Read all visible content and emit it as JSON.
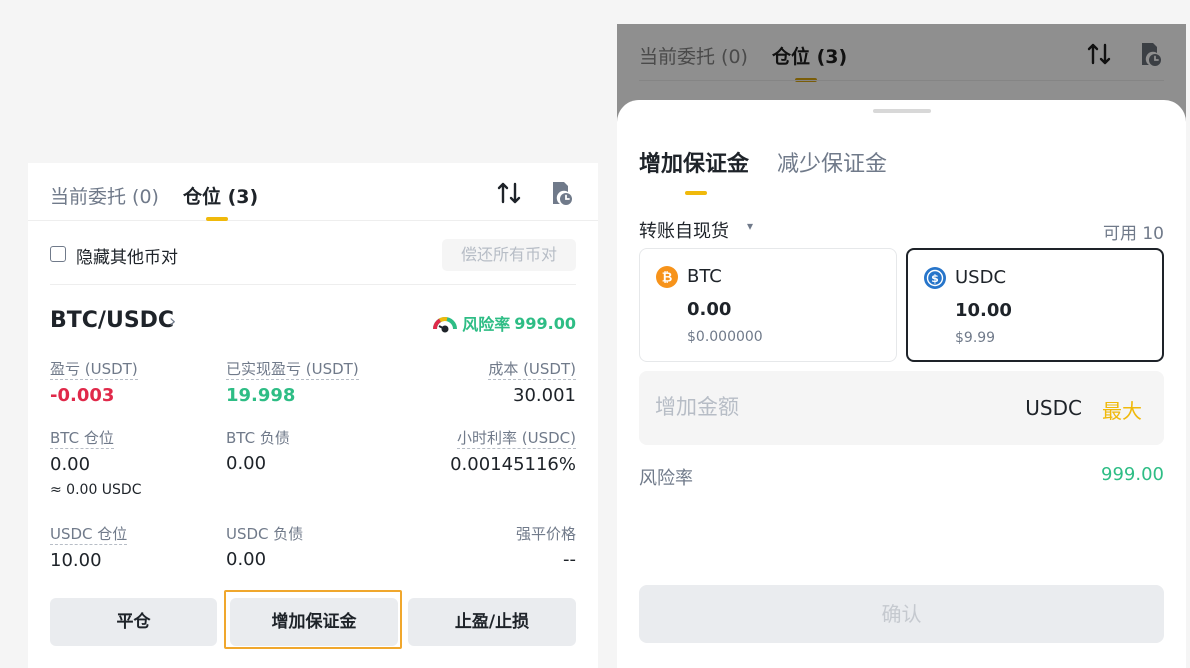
{
  "left": {
    "tabs": {
      "open_orders": "当前委托 (0)",
      "positions": "仓位 (3)"
    },
    "hide_other_pairs": "隐藏其他币对",
    "repay_all": "偿还所有币对",
    "pair": "BTC/USDC",
    "pair_chevron": "›",
    "risk": {
      "label": "风险率",
      "value": "999.00"
    },
    "stats": {
      "pnl": {
        "label": "盈亏 (USDT)",
        "value": "-0.003"
      },
      "realized_pnl": {
        "label": "已实现盈亏 (USDT)",
        "value": "19.998"
      },
      "cost": {
        "label": "成本 (USDT)",
        "value": "30.001"
      },
      "btc_position": {
        "label": "BTC 仓位",
        "value": "0.00",
        "sub": "≈ 0.00 USDC"
      },
      "btc_debt": {
        "label": "BTC 负债",
        "value": "0.00"
      },
      "hourly_rate": {
        "label": "小时利率 (USDC)",
        "value": "0.00145116%"
      },
      "usdc_position": {
        "label": "USDC 仓位",
        "value": "10.00"
      },
      "usdc_debt": {
        "label": "USDC 负债",
        "value": "0.00"
      },
      "liq_price": {
        "label": "强平价格",
        "value": "--"
      }
    },
    "buttons": {
      "close": "平仓",
      "add_margin": "增加保证金",
      "tp_sl": "止盈/止损"
    }
  },
  "right": {
    "tabs": {
      "open_orders": "当前委托 (0)",
      "positions": "仓位 (3)"
    },
    "sheet": {
      "tabs": {
        "add": "增加保证金",
        "reduce": "减少保证金"
      },
      "transfer_from": "转账自现货",
      "transfer_caret": "▾",
      "available": "可用 10",
      "assets": [
        {
          "name": "BTC",
          "amount": "0.00",
          "usd": "$0.000000",
          "icon": "bitcoin-icon",
          "color": "#f7931a",
          "selected": false
        },
        {
          "name": "USDC",
          "amount": "10.00",
          "usd": "$9.99",
          "icon": "usdc-icon",
          "color": "#2775ca",
          "selected": true
        }
      ],
      "amount_placeholder": "增加金额",
      "amount_unit": "USDC",
      "max": "最大",
      "risk_label": "风险率",
      "risk_value": "999.00",
      "confirm": "确认"
    }
  },
  "colors": {
    "accent": "#f0b90b",
    "green": "#2ebd85",
    "red": "#e0294a",
    "highlight": "#f0a72d"
  }
}
